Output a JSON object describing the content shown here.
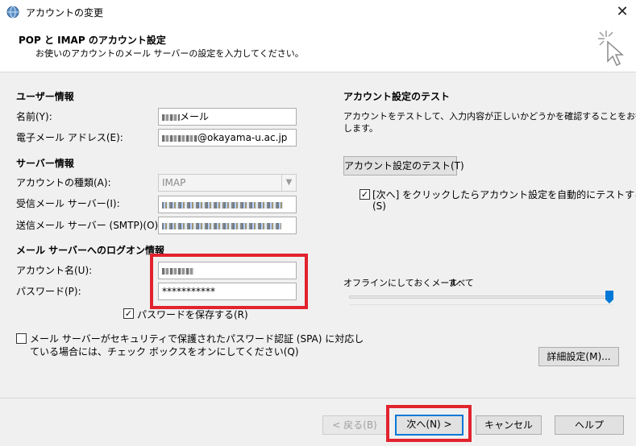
{
  "window": {
    "title": "アカウントの変更",
    "close_glyph": "✕"
  },
  "header": {
    "title": "POP と IMAP のアカウント設定",
    "subtitle": "お使いのアカウントのメール サーバーの設定を入力してください。"
  },
  "user_info": {
    "section": "ユーザー情報",
    "name_label": "名前(Y):",
    "name_value_suffix": "メール",
    "email_label": "電子メール アドレス(E):",
    "email_value_suffix": "@okayama-u.ac.jp"
  },
  "server_info": {
    "section": "サーバー情報",
    "account_type_label": "アカウントの種類(A):",
    "account_type_value": "IMAP",
    "incoming_label": "受信メール サーバー(I):",
    "outgoing_label": "送信メール サーバー (SMTP)(O):"
  },
  "logon_info": {
    "section": "メール サーバーへのログオン情報",
    "account_name_label": "アカウント名(U):",
    "password_label": "パスワード(P):",
    "password_value": "***********",
    "save_password_label": "パスワードを保存する(R)",
    "save_password_checked": true,
    "spa_label_line1": "メール サーバーがセキュリティで保護されたパスワード認証 (SPA) に対応し",
    "spa_label_line2": "ている場合には、チェック ボックスをオンにしてください(Q)",
    "spa_checked": false
  },
  "test_section": {
    "title": "アカウント設定のテスト",
    "desc_line1": "アカウントをテストして、入力内容が正しいかどうかを確認することをお勧め",
    "desc_line2": "します。",
    "test_button": "アカウント設定のテスト(T)",
    "auto_test_line1": "[次へ] をクリックしたらアカウント設定を自動的にテストする",
    "auto_test_line2": "(S)",
    "auto_test_checked": true
  },
  "offline": {
    "label": "オフラインにしておくメール:",
    "value": "すべて",
    "slider_level": 1.0
  },
  "buttons": {
    "advanced": "詳細設定(M)...",
    "back": "< 戻る(B)",
    "next": "次へ(N) >",
    "cancel": "キャンセル",
    "help": "ヘルプ"
  },
  "highlight_color": "#e1232e",
  "accent_color": "#0078d7"
}
